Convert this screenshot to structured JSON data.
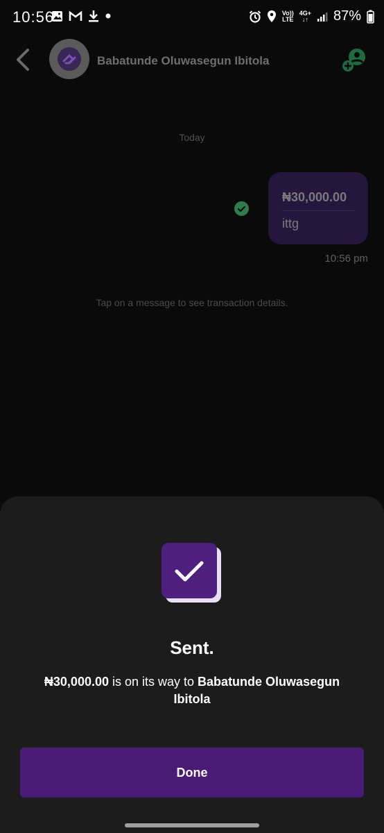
{
  "status_bar": {
    "time": "10:56",
    "battery_percent": "87%",
    "network_volte": "Vo))",
    "network_lte": "LTE",
    "network_4g": "4G+"
  },
  "header": {
    "contact_name": "Babatunde Oluwasegun Ibitola"
  },
  "chat": {
    "date_label": "Today",
    "message_amount": "₦30,000.00",
    "message_note": "ittg",
    "message_time": "10:56 pm",
    "hint": "Tap on a message to see transaction details."
  },
  "sheet": {
    "title": "Sent.",
    "amount": "₦30,000.00",
    "message_middle": " is on its way to ",
    "recipient": "Babatunde Oluwasegun Ibitola",
    "done_label": "Done"
  },
  "colors": {
    "accent": "#4a1b75",
    "success_green": "#2e7d4f",
    "bubble": "#25163d",
    "sheet": "#1c1c1c"
  },
  "icons": [
    "back-icon",
    "avatar-logo-icon",
    "add-contact-icon",
    "check-circle-icon",
    "checkmark-icon",
    "gallery-icon",
    "gmail-icon",
    "download-icon",
    "alarm-icon",
    "location-icon",
    "signal-icon",
    "battery-icon"
  ]
}
